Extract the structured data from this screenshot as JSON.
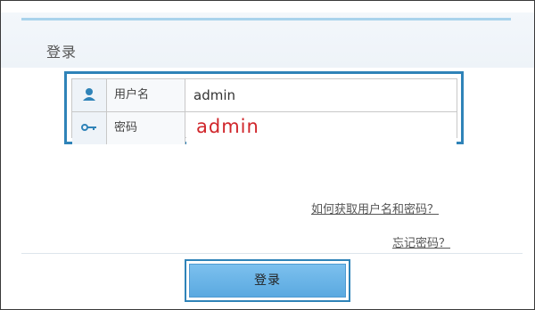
{
  "dialog": {
    "title": "登录"
  },
  "form": {
    "username": {
      "icon": "user-icon",
      "label": "用户名",
      "value": "admin"
    },
    "password": {
      "icon": "key-icon",
      "label": "密码",
      "value": "admin"
    }
  },
  "links": {
    "how_to_get": "如何获取用户名和密码？",
    "forgot_password": "忘记密码？"
  },
  "actions": {
    "login_label": "登录"
  },
  "colors": {
    "accent_border": "#2f83b8",
    "password_text": "#d0262b",
    "button_fill": "#6db6e8"
  }
}
